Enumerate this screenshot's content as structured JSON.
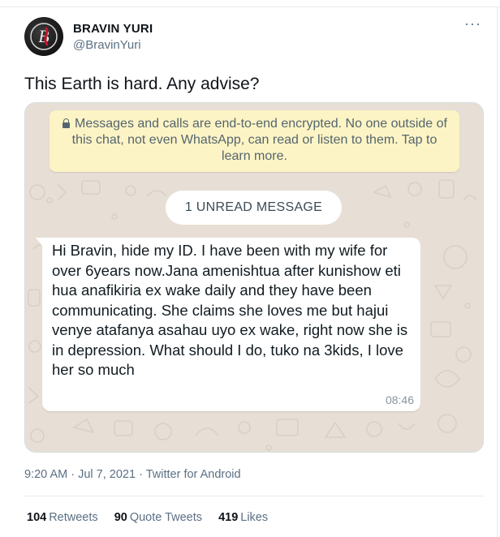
{
  "author": {
    "display_name": "BRAVIN YURI",
    "handle": "@BravinYuri",
    "avatar_letter": "B"
  },
  "more_label": "···",
  "tweet_text": "This Earth is hard. Any advise?",
  "screenshot": {
    "encryption_notice": "Messages and calls are end-to-end encrypted. No one outside of this chat, not even WhatsApp, can read or listen to them. Tap to learn more.",
    "unread_label": "1 UNREAD MESSAGE",
    "message": {
      "text": "Hi Bravin, hide my ID. I have been with my wife for over 6years now.Jana amenishtua after kunishow eti hua anafikiria ex wake daily and they have been communicating. She claims she loves me but hajui venye atafanya asahau uyo ex wake, right now she is in depression. What should I do, tuko na 3kids, I love her so much",
      "time": "08:46"
    },
    "colors": {
      "chat_background": "#e7dfd5",
      "notice_background": "#fdf4c5",
      "bubble_background": "#ffffff"
    }
  },
  "meta": {
    "time": "9:20 AM",
    "date": "Jul 7, 2021",
    "source": "Twitter for Android",
    "separator": "·"
  },
  "stats": {
    "retweets_count": "104",
    "retweets_label": "Retweets",
    "quotes_count": "90",
    "quotes_label": "Quote Tweets",
    "likes_count": "419",
    "likes_label": "Likes"
  }
}
